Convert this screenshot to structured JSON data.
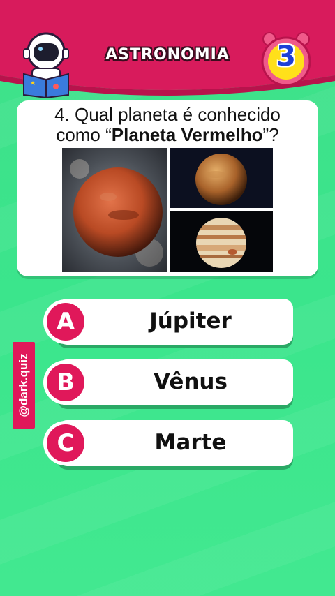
{
  "header": {
    "category": "ASTRONOMIA",
    "timer": "3",
    "colors": {
      "header_bg": "#d81b5c",
      "timer_ring": "#f05a8a",
      "timer_face": "#ffe01a",
      "timer_number": "#1e3fd6"
    }
  },
  "question": {
    "prefix": "4. Qual planeta é conhecido",
    "middle": "como “",
    "bold": "Planeta Vermelho",
    "suffix": "”?"
  },
  "images": [
    {
      "icon": "mars-planet-image"
    },
    {
      "icon": "venus-planet-image"
    },
    {
      "icon": "jupiter-planet-image"
    }
  ],
  "options": [
    {
      "letter": "A",
      "text": "Júpiter"
    },
    {
      "letter": "B",
      "text": "Vênus"
    },
    {
      "letter": "C",
      "text": "Marte"
    }
  ],
  "watermark": "@dark.quiz",
  "colors": {
    "accent": "#e0185a",
    "background": "#3fe08a"
  }
}
